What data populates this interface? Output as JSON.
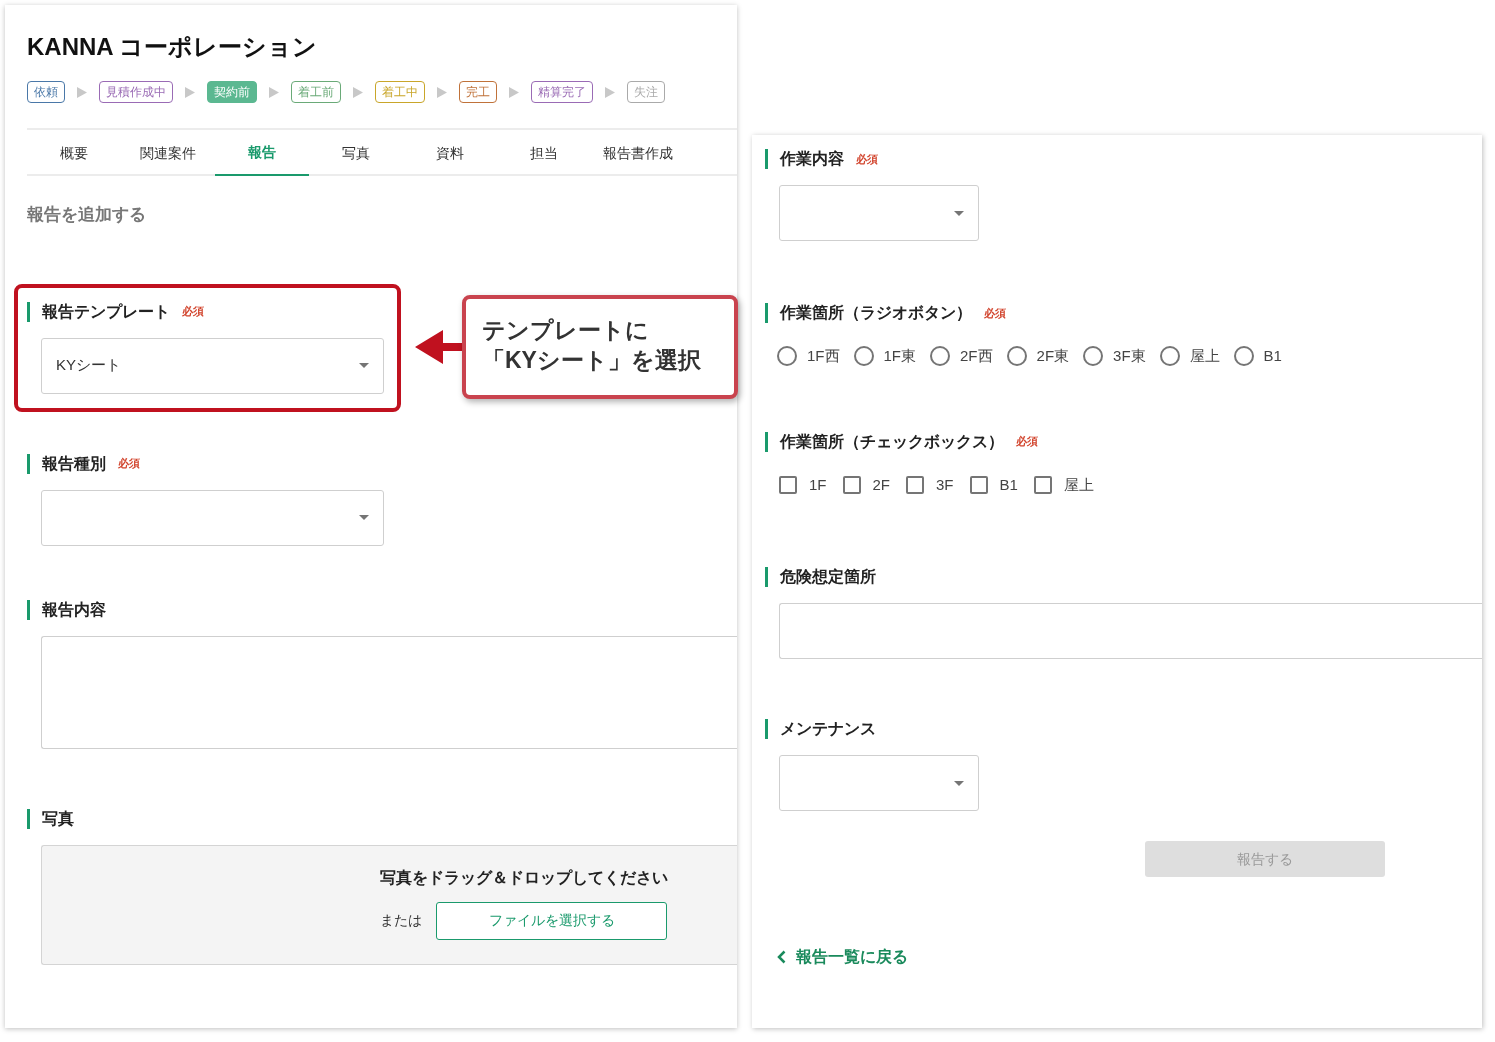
{
  "company": "KANNA コーポレーション",
  "steps": [
    {
      "label": "依頼",
      "color": "#4a78a8",
      "selected": false
    },
    {
      "label": "見積作成中",
      "color": "#9a6bb5",
      "selected": false
    },
    {
      "label": "契約前",
      "color": "#5bb891",
      "selected": true
    },
    {
      "label": "着工前",
      "color": "#6aaa78",
      "selected": false
    },
    {
      "label": "着工中",
      "color": "#c9a62a",
      "selected": false
    },
    {
      "label": "完工",
      "color": "#c0723a",
      "selected": false
    },
    {
      "label": "精算完了",
      "color": "#9a6bb5",
      "selected": false
    },
    {
      "label": "失注",
      "color": "#aaaaaa",
      "selected": false
    }
  ],
  "tabs": [
    {
      "label": "概要",
      "selected": false
    },
    {
      "label": "関連案件",
      "selected": false
    },
    {
      "label": "報告",
      "selected": true
    },
    {
      "label": "写真",
      "selected": false
    },
    {
      "label": "資料",
      "selected": false
    },
    {
      "label": "担当",
      "selected": false
    },
    {
      "label": "報告書作成",
      "selected": false
    }
  ],
  "section_title": "報告を追加する",
  "left_fields": [
    {
      "kind": "select",
      "label": "報告テンプレート",
      "required": "必須",
      "value": "KYシート",
      "highlighted": true
    },
    {
      "kind": "select",
      "label": "報告種別",
      "required": "必須",
      "highlighted": false
    },
    {
      "kind": "textarea",
      "label": "報告内容",
      "highlighted": false
    },
    {
      "kind": "dropzone",
      "label": "写真",
      "highlighted": false,
      "prompt": "写真をドラッグ＆ドロップしてください",
      "or": "または",
      "button": "ファイルを選択する"
    }
  ],
  "callout": {
    "lines": [
      "テンプレートに",
      "「KYシート」を選択"
    ]
  },
  "right_fields": [
    {
      "kind": "select",
      "label": "作業内容",
      "required": "必須"
    },
    {
      "kind": "radio",
      "label": "作業箇所（ラジオボタン）",
      "required": "必須",
      "options": [
        {
          "label": "1F西",
          "selected": false
        },
        {
          "label": "1F東",
          "selected": false
        },
        {
          "label": "2F西",
          "selected": false
        },
        {
          "label": "2F東",
          "selected": false
        },
        {
          "label": "3F東",
          "selected": false
        },
        {
          "label": "屋上",
          "selected": false
        },
        {
          "label": "B1",
          "selected": false
        }
      ]
    },
    {
      "kind": "checkbox",
      "label": "作業箇所（チェックボックス）",
      "required": "必須",
      "options": [
        {
          "label": "1F",
          "checked": false
        },
        {
          "label": "2F",
          "checked": false
        },
        {
          "label": "3F",
          "checked": false
        },
        {
          "label": "B1",
          "checked": false
        },
        {
          "label": "屋上",
          "checked": false
        }
      ]
    },
    {
      "kind": "text",
      "label": "危険想定箇所"
    },
    {
      "kind": "select",
      "label": "メンテナンス"
    }
  ],
  "submit": {
    "label": "報告する",
    "disabled": true
  },
  "back_link": "報告一覧に戻る"
}
